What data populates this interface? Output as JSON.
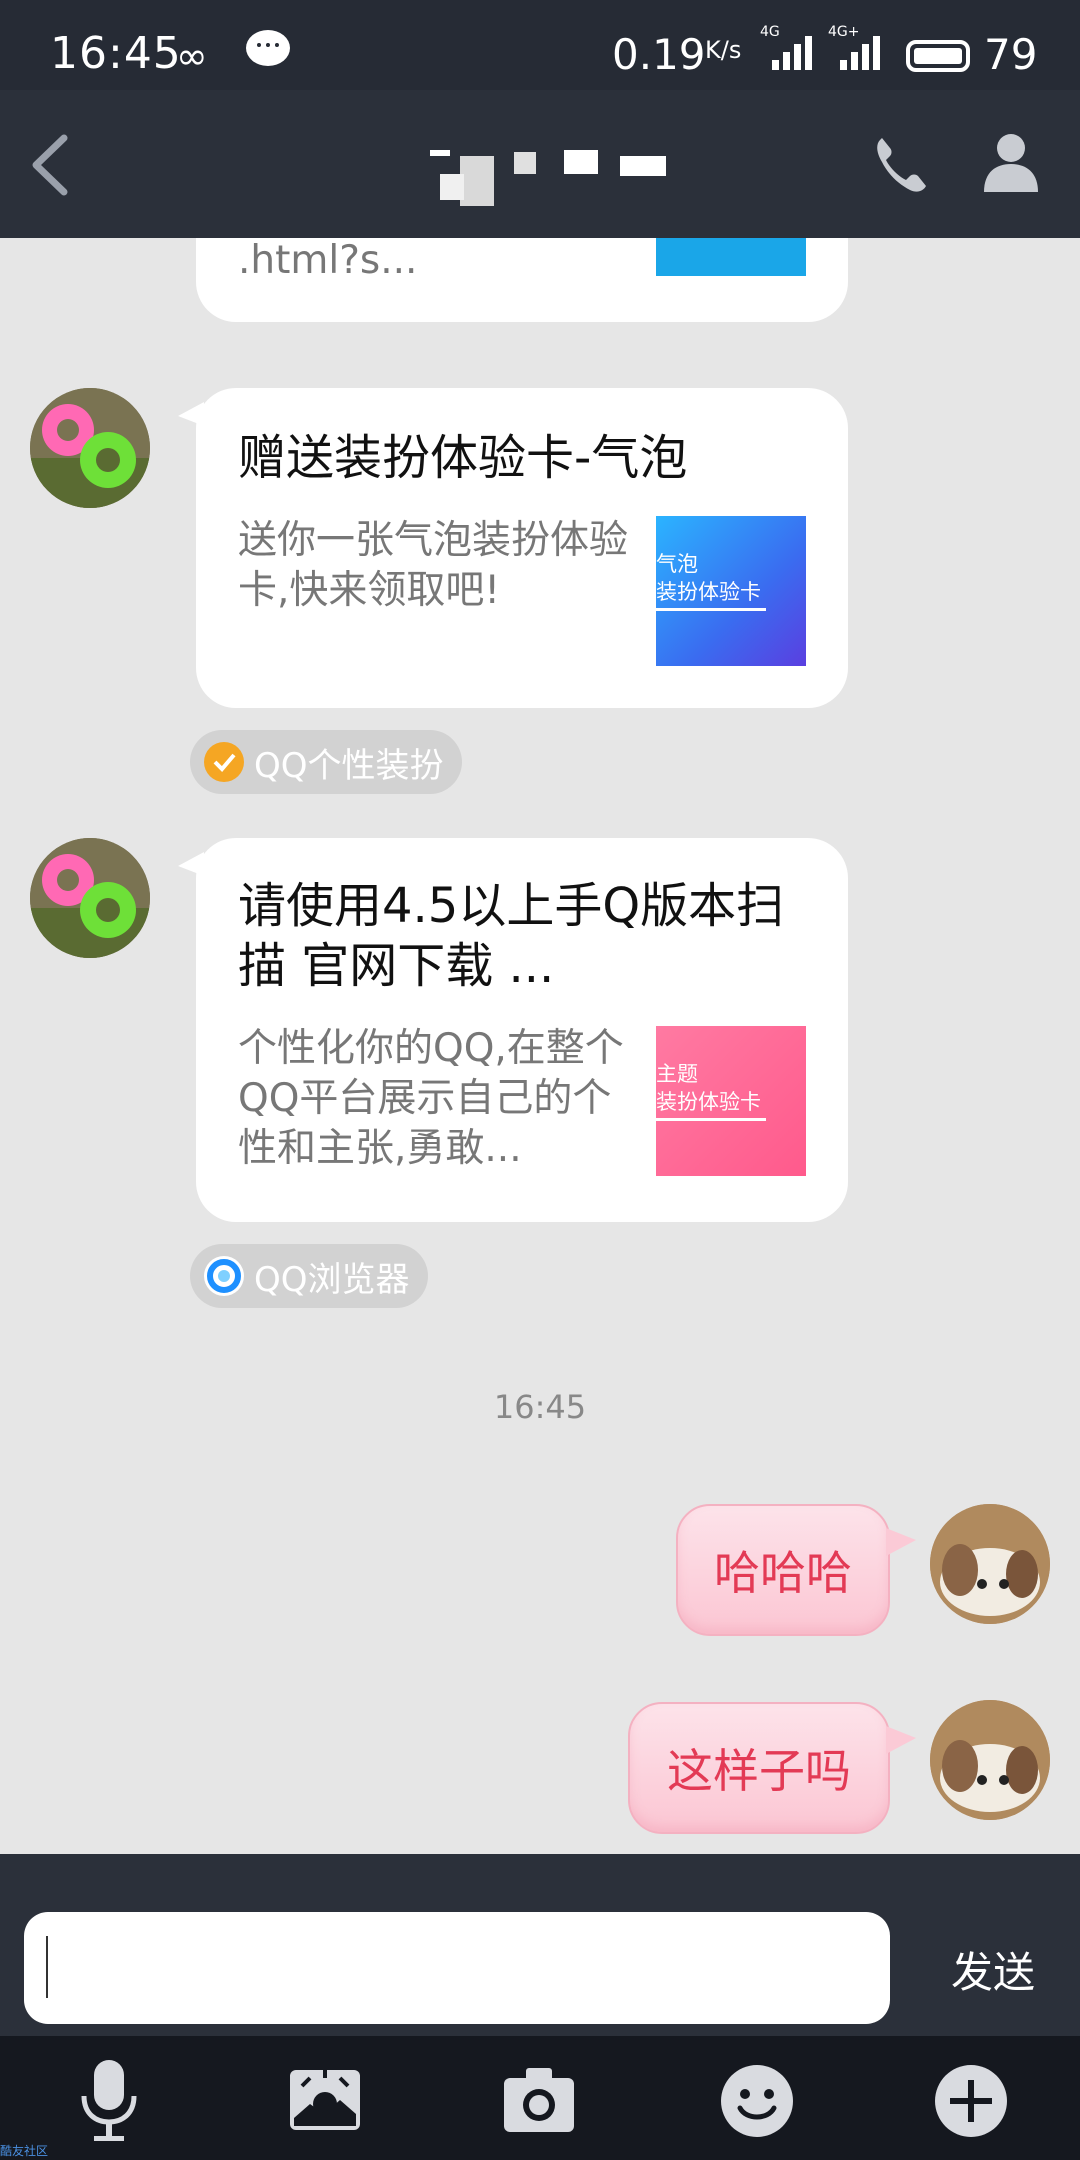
{
  "status_bar": {
    "time": "16:45",
    "network_speed": "0.19",
    "network_speed_unit": "K/s",
    "signal1_label": "4G",
    "signal2_label": "4G+",
    "battery": "79"
  },
  "chat": {
    "partial_card": {
      "url_text": ".html?s..."
    },
    "messages": [
      {
        "title": "赠送装扮体验卡-气泡",
        "description": "送你一张气泡装扮体验卡,快来领取吧!",
        "thumb_line1": "气泡",
        "thumb_line2": "装扮体验卡",
        "source": "QQ个性装扮"
      },
      {
        "title": "请使用4.5以上手Q版本扫描 官网下载 ...",
        "description": "个性化你的QQ,在整个QQ平台展示自己的个性和主张,勇敢...",
        "thumb_line1": "主题",
        "thumb_line2": "装扮体验卡",
        "source": "QQ浏览器"
      }
    ],
    "timestamp": "16:45",
    "outgoing": [
      {
        "text": "哈哈哈"
      },
      {
        "text": "这样子吗"
      }
    ]
  },
  "input": {
    "value": "",
    "send_label": "发送"
  },
  "corner_label": "酷友社区",
  "colors": {
    "header_bg": "#2b303a",
    "status_bg": "#262b35",
    "chat_bg": "#e6e6e6",
    "bubble_text": "#e33a55",
    "toolbar_bg": "#15181f"
  }
}
